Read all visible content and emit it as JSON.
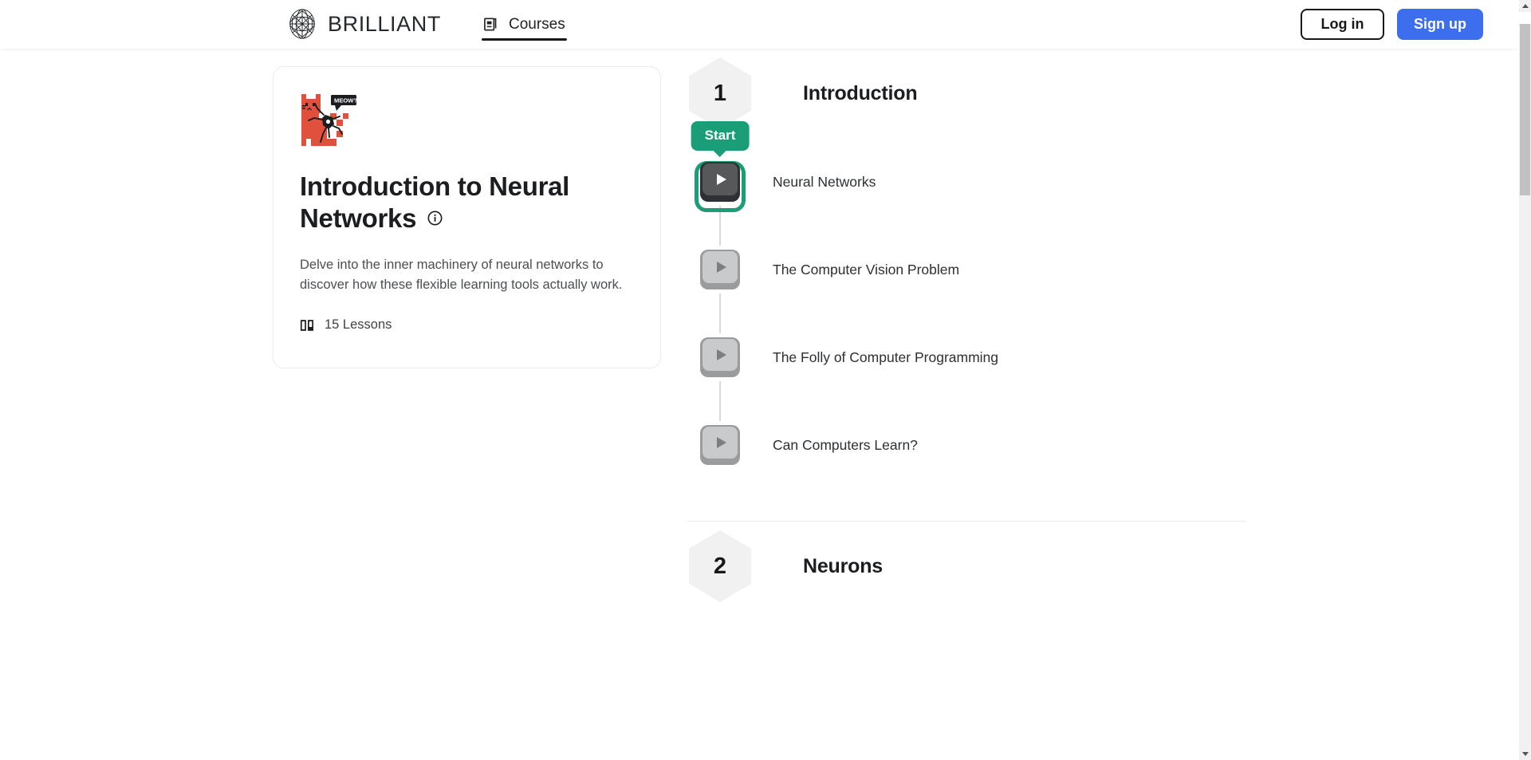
{
  "header": {
    "brand_name": "BRILLIANT",
    "brand_icon": "brilliant-globe-logo",
    "nav": {
      "courses_label": "Courses",
      "courses_icon": "courses-card-stack-icon"
    },
    "login_label": "Log in",
    "signup_label": "Sign up",
    "signup_color": "#3c6eee"
  },
  "course_card": {
    "art_icon": "pixel-cat-neuron-meow-art",
    "art_speech_text": "MEOW?",
    "title": "Introduction to Neural Networks",
    "info_icon": "info-circle-icon",
    "description": "Delve into the inner machinery of neural networks to discover how these flexible learning tools actually work.",
    "lessons_icon": "open-book-icon",
    "lessons_count_label": "15 Lessons"
  },
  "syllabus": {
    "units": [
      {
        "number": "1",
        "title": "Introduction",
        "lessons": [
          {
            "label": "Neural Networks",
            "state": "active",
            "badge": "Start",
            "icon": "play-triangle-icon"
          },
          {
            "label": "The Computer Vision Problem",
            "state": "locked",
            "badge": null,
            "icon": "play-triangle-icon"
          },
          {
            "label": "The Folly of Computer Programming",
            "state": "locked",
            "badge": null,
            "icon": "play-triangle-icon"
          },
          {
            "label": "Can Computers Learn?",
            "state": "locked",
            "badge": null,
            "icon": "play-triangle-icon"
          }
        ]
      },
      {
        "number": "2",
        "title": "Neurons",
        "lessons": []
      }
    ]
  },
  "colors": {
    "accent_green": "#1a9e78",
    "brand_blue": "#3c6eee",
    "art_red": "#e0503c",
    "text_dark": "#1b1d20",
    "hex_fill": "#f1f1f1"
  },
  "scrollbar": {
    "up_icon": "scroll-up-arrow-icon",
    "down_icon": "scroll-down-arrow-icon"
  }
}
